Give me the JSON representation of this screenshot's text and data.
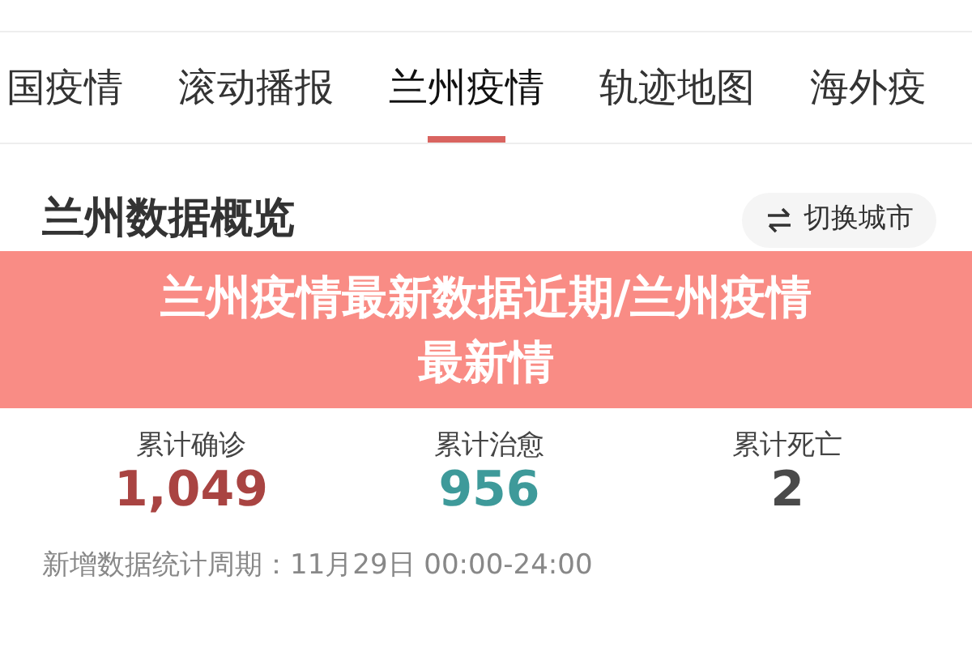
{
  "tabs": [
    {
      "label": "国疫情",
      "selected": false
    },
    {
      "label": "滚动播报",
      "selected": false
    },
    {
      "label": "兰州疫情",
      "selected": true
    },
    {
      "label": "轨迹地图",
      "selected": false
    },
    {
      "label": "海外疫",
      "selected": false
    }
  ],
  "card": {
    "title": "兰州数据概览",
    "switch_button": "切换城市",
    "total_stats": [
      {
        "label": "累计确诊",
        "value": "1,049",
        "color": "#a94442"
      },
      {
        "label": "累计治愈",
        "value": "956",
        "color": "#3e9a9a"
      },
      {
        "label": "累计死亡",
        "value": "2",
        "color": "#4a4a4a"
      }
    ],
    "period": "新增数据统计周期：11月29日 00:00-24:00"
  },
  "banner": {
    "lines": [
      "兰州疫情最新数据近期/兰州疫情",
      "最新情"
    ]
  }
}
